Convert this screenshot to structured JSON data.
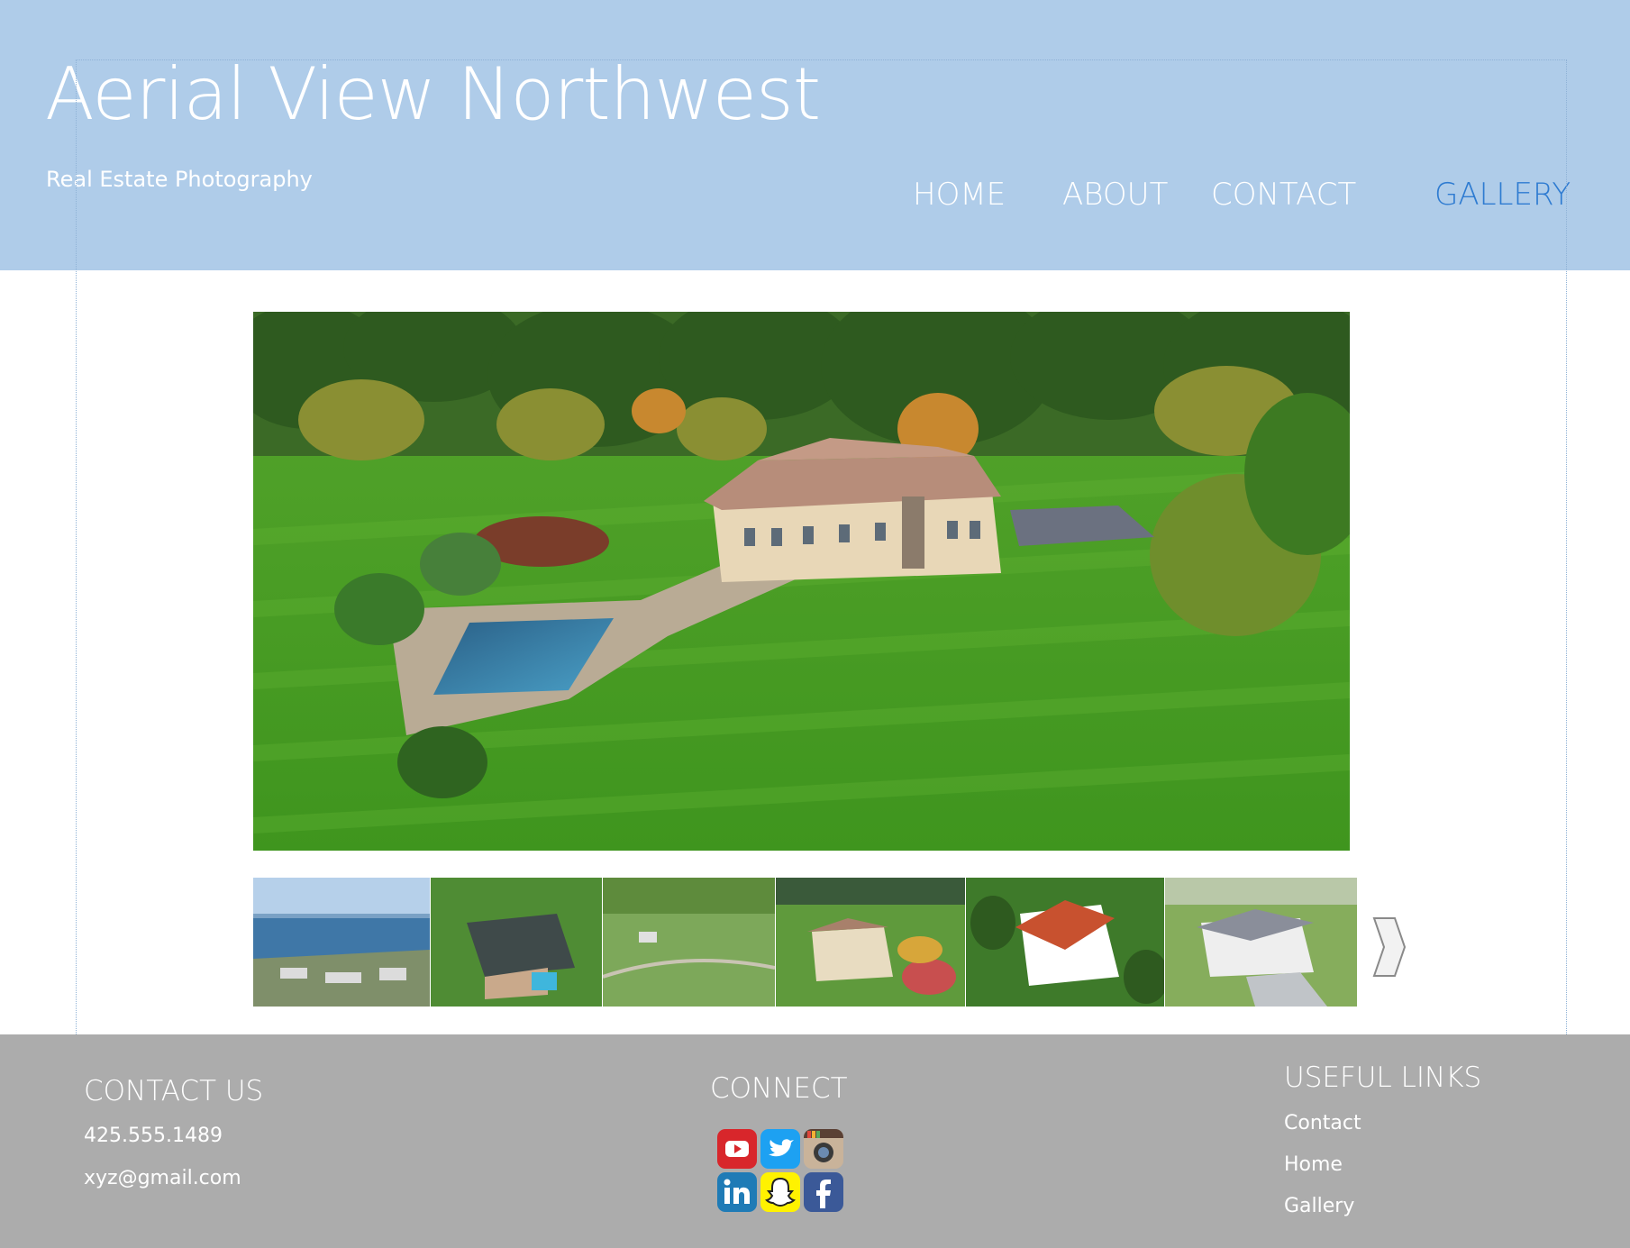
{
  "header": {
    "title": "Aerial View Northwest",
    "tagline": "Real Estate Photography",
    "nav": [
      {
        "label": "HOME",
        "active": false
      },
      {
        "label": "ABOUT",
        "active": false
      },
      {
        "label": "CONTACT",
        "active": false
      },
      {
        "label": "GALLERY",
        "active": true
      }
    ]
  },
  "gallery": {
    "main_image": "aerial house with pool and lawn",
    "thumbnails": [
      "waterfront aerial",
      "house with pool",
      "green fields",
      "house with garden",
      "house with red roof",
      "white house"
    ]
  },
  "footer": {
    "contact": {
      "heading": "CONTACT US",
      "phone": "425.555.1489",
      "email": "xyz@gmail.com"
    },
    "connect": {
      "heading": "CONNECT",
      "social": [
        "youtube-icon",
        "twitter-icon",
        "instagram-icon",
        "linkedin-icon",
        "snapchat-icon",
        "facebook-icon"
      ]
    },
    "links": {
      "heading": "USEFUL LINKS",
      "items": [
        "Contact",
        "Home",
        "Gallery"
      ]
    }
  },
  "colors": {
    "header_bg": "#afcce9",
    "footer_bg": "#acacac",
    "nav_active": "#2e7bd1"
  }
}
